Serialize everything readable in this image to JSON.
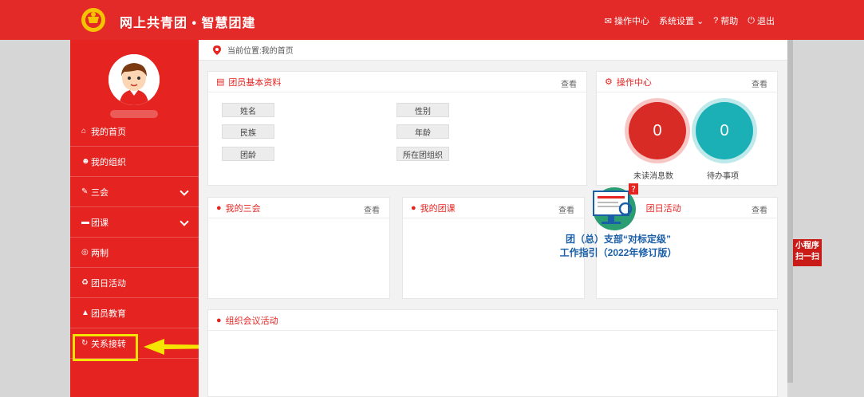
{
  "header": {
    "brand": "网上共青团 • 智慧团建",
    "nav": [
      {
        "icon": "mail-icon",
        "label": "操作中心"
      },
      {
        "icon": "",
        "label": "系统设置"
      },
      {
        "icon": "help-icon",
        "label": "帮助"
      },
      {
        "icon": "power-icon",
        "label": "退出"
      }
    ]
  },
  "sidebar": {
    "items": [
      {
        "icon": "home-icon",
        "label": "我的首页"
      },
      {
        "icon": "group-icon",
        "label": "我的组织"
      },
      {
        "icon": "edit-icon",
        "label": "三会"
      },
      {
        "icon": "folder-icon",
        "label": "团课"
      },
      {
        "icon": "target-icon",
        "label": "两制"
      },
      {
        "icon": "recycle-icon",
        "label": "团日活动"
      },
      {
        "icon": "graduation-cap-icon",
        "label": "团员教育"
      },
      {
        "icon": "refresh-icon",
        "label": "关系接转"
      }
    ]
  },
  "breadcrumb": "当前位置:我的首页",
  "panels": {
    "profile": {
      "title": "团员基本资料",
      "view": "查看",
      "fields": [
        "姓名",
        "民族",
        "团龄",
        "性别",
        "年龄",
        "所在团组织"
      ]
    },
    "ops": {
      "title": "操作中心",
      "view": "查看",
      "unread_value": "0",
      "unread_label": "未读消息数",
      "todo_value": "0",
      "todo_label": "待办事项"
    },
    "sanhui": {
      "title": "我的三会",
      "view": "查看"
    },
    "tuanke": {
      "title": "我的团课",
      "view": "查看"
    },
    "tuanri": {
      "title": "团日活动",
      "view": "查看"
    },
    "meeting": {
      "title": "组织会议活动"
    }
  },
  "promo": {
    "line1": "团（总）支部“对标定级”",
    "line2": "工作指引（2022年修订版）"
  },
  "mini": {
    "line1": "小程序",
    "line2": "扫一扫"
  },
  "colors": {
    "primary": "#e52421",
    "teal": "#1bb0b5",
    "highlight": "#f5e400"
  }
}
